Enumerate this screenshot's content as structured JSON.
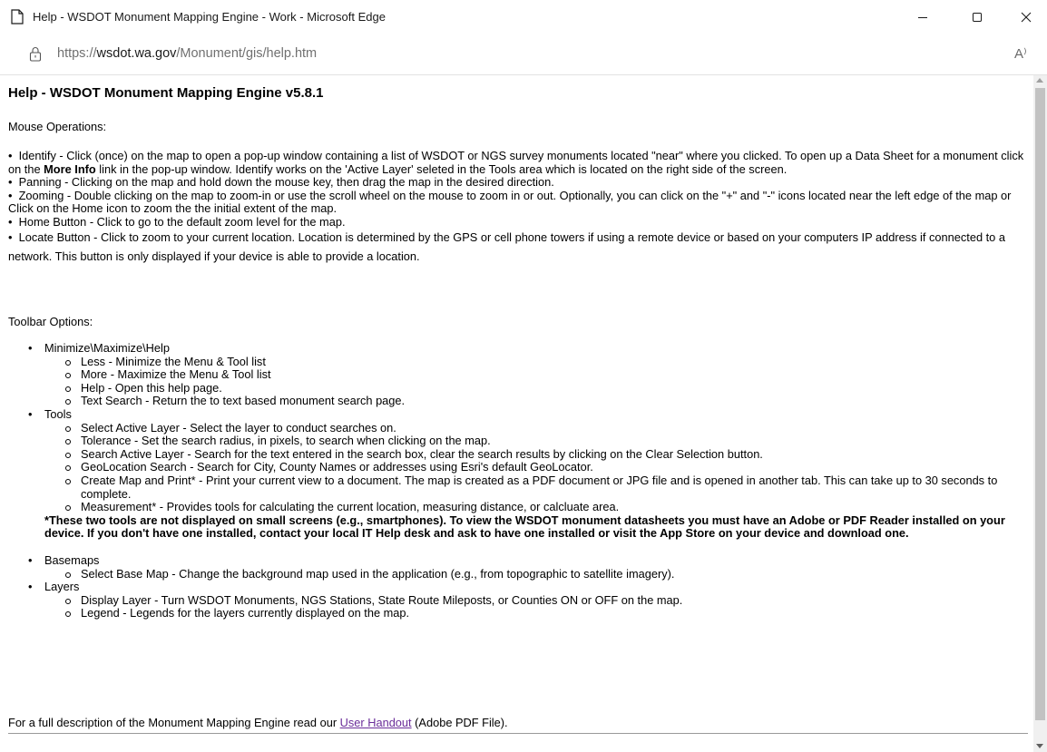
{
  "window": {
    "title": "Help - WSDOT Monument Mapping Engine - Work - Microsoft Edge",
    "icons": [
      "page-icon",
      "minimize-icon",
      "maximize-icon",
      "close-icon"
    ]
  },
  "address_bar": {
    "url_prefix": "https://",
    "url_domain": "wsdot.wa.gov",
    "url_path": "/Monument/gis/help.htm",
    "read_aloud_label": "A⁾"
  },
  "page": {
    "heading": "Help - WSDOT Monument Mapping Engine v5.8.1",
    "mouse_heading": "Mouse Operations:",
    "mouse_items": {
      "identify_pre": "Identify - Click (once) on the map to open a pop-up window containing a list of WSDOT or NGS survey monuments located \"near\" where you clicked. To open up a Data Sheet for a monument click on the ",
      "identify_bold": "More Info",
      "identify_post": " link in the pop-up window. Identify works on the 'Active Layer' seleted in the Tools area which is located on the right side of the screen.",
      "panning": "Panning - Clicking on the map and hold down the mouse key, then drag the map in the desired direction.",
      "zooming": "Zooming - Double clicking on the map to zoom-in or use the scroll wheel on the mouse to zoom in or out. Optionally, you can click on the \"+\" and \"-\" icons located near the left edge of the map or Click on the Home icon to zoom the the initial extent of the map.",
      "home": "Home Button - Click to go to the default zoom level for the map.",
      "locate": " Locate Button - Click to zoom to your current location. Location is determined by the GPS or cell phone towers if using a remote device or based on your computers IP address if connected to a network. This button is only displayed if your device is able to provide a location."
    },
    "toolbar_heading": "Toolbar Options:",
    "toolbar": {
      "minmax": {
        "label": "Minimize\\Maximize\\Help",
        "items": [
          "Less - Minimize the Menu & Tool list",
          "More - Maximize the Menu & Tool list",
          "Help - Open this help page.",
          "Text Search - Return the to text based monument search page."
        ]
      },
      "tools": {
        "label": "Tools",
        "items": [
          "Select Active Layer - Select the layer to conduct searches on.",
          "Tolerance - Set the search radius, in pixels, to search when clicking on the map.",
          "Search Active Layer - Search for the text entered in the search box, clear the search results by clicking on the Clear Selection button.",
          "GeoLocation Search - Search for City, County Names or addresses using Esri's default GeoLocator.",
          "Create Map and Print* - Print your current view to a document. The map is created as a PDF document or JPG file and is opened in another tab. This can take up to 30 seconds to complete.",
          "Measurement* - Provides tools for calculating the current location, measuring distance, or calcluate area."
        ],
        "note": "*These two tools are not displayed on small screens (e.g., smartphones). To view the WSDOT monument datasheets you must have an Adobe or PDF Reader installed on your device. If you don't have one installed, contact your local IT Help desk and ask to have one installed or visit the App Store on your device and download one."
      },
      "basemaps": {
        "label": "Basemaps",
        "items": [
          "Select Base Map - Change the background map used in the application (e.g., from topographic to satellite imagery)."
        ]
      },
      "layers": {
        "label": "Layers",
        "items": [
          "Display Layer - Turn WSDOT Monuments, NGS Stations, State Route Mileposts, or Counties ON or OFF on the map.",
          "Legend - Legends for the layers currently displayed on the map."
        ]
      }
    },
    "footer": {
      "pre": "For a full description of the Monument Mapping Engine read our ",
      "link": "User Handout",
      "post": " (Adobe PDF File)."
    }
  },
  "colors": {
    "link_visited": "#6b2e9a",
    "scroll_thumb": "#c2c2c2"
  }
}
